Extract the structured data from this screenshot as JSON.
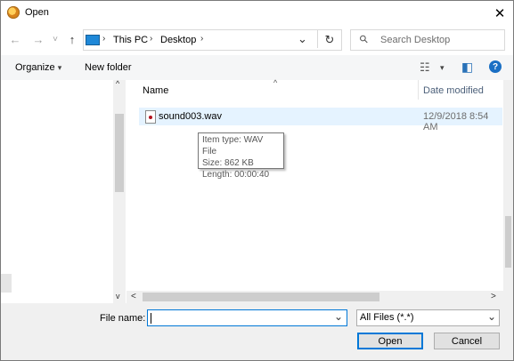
{
  "window": {
    "title": "Open",
    "close_glyph": "✕"
  },
  "nav": {
    "back_glyph": "←",
    "forward_glyph": "→",
    "recent_glyph": "˅",
    "up_glyph": "↑"
  },
  "address": {
    "crumbs": [
      "This PC",
      "Desktop"
    ],
    "separator": "›",
    "dropdown_glyph": "⌄",
    "refresh_glyph": "↻"
  },
  "search": {
    "placeholder": "Search Desktop",
    "icon_glyph": "⚲"
  },
  "toolbar": {
    "organize_label": "Organize",
    "organize_arrow": "▾",
    "new_folder_label": "New folder",
    "view_glyph": "☷",
    "view_arrow": "▾",
    "pane_glyph": "◧",
    "help_glyph": "?"
  },
  "list": {
    "sort_glyph": "^",
    "columns": [
      "Name",
      "Date modified"
    ],
    "files": [
      {
        "name": "sound003.wav",
        "date_modified": "12/9/2018 8:54 AM"
      }
    ]
  },
  "tooltip": {
    "line1": "Item type: WAV File",
    "line2": "Size: 862 KB",
    "line3": "Length: 00:00:40"
  },
  "scroll": {
    "up": "^",
    "down": "v",
    "left": "<",
    "right": ">"
  },
  "bottom": {
    "file_name_label": "File name:",
    "file_name_value": "",
    "file_name_dropdown": "⌄",
    "filter_value": "All Files (*.*)",
    "filter_dropdown": "⌄",
    "open_label": "Open",
    "cancel_label": "Cancel"
  },
  "colors": {
    "accent": "#0078d7",
    "selection": "#e5f3ff",
    "help": "#1a6fc4"
  }
}
